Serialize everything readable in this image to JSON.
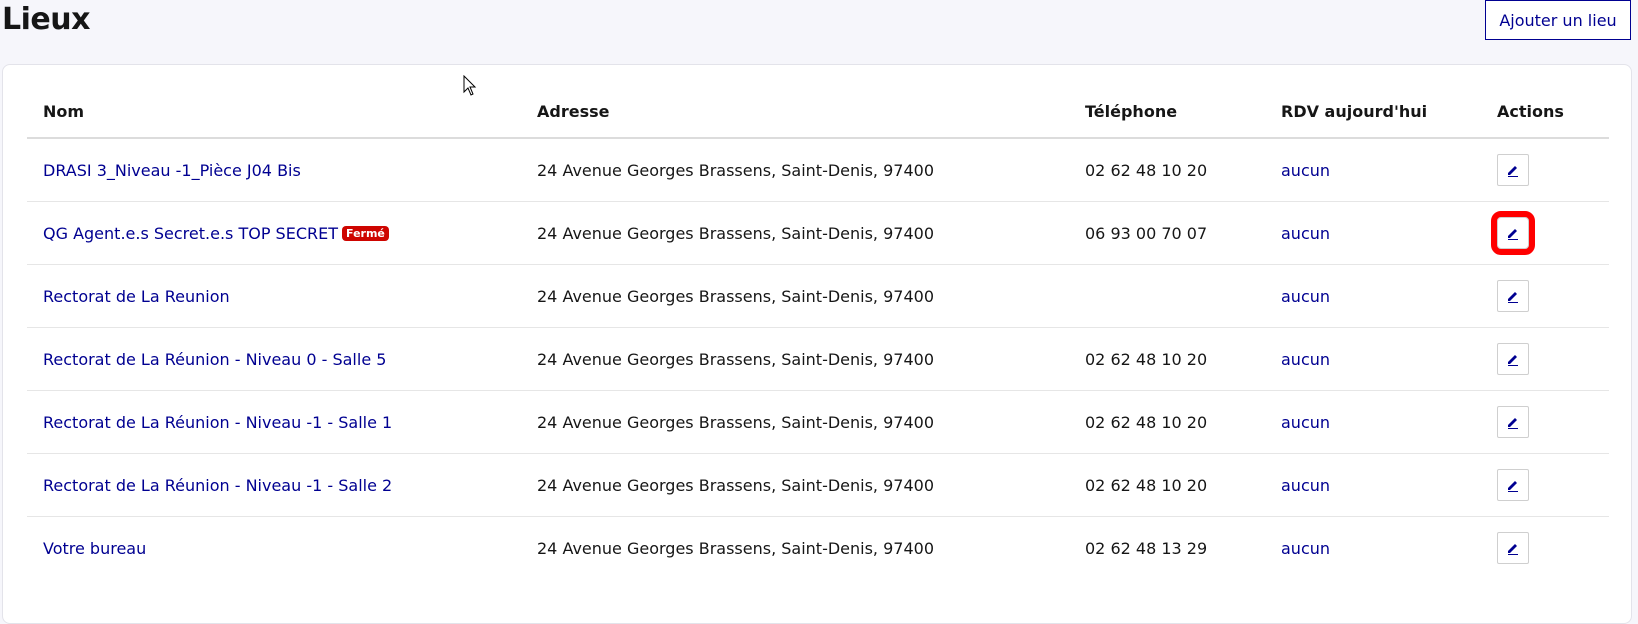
{
  "page": {
    "title": "Lieux",
    "add_button_label": "Ajouter un lieu"
  },
  "table": {
    "headers": {
      "nom": "Nom",
      "adresse": "Adresse",
      "telephone": "Téléphone",
      "rdv": "RDV aujourd'hui",
      "actions": "Actions"
    },
    "rows": [
      {
        "nom": "DRASI 3_Niveau -1_Pièce J04 Bis",
        "badge": "",
        "adresse": "24 Avenue Georges Brassens, Saint-Denis, 97400",
        "telephone": "02 62 48 10 20",
        "rdv": "aucun"
      },
      {
        "nom": "QG Agent.e.s Secret.e.s TOP SECRET",
        "badge": "Fermé",
        "adresse": "24 Avenue Georges Brassens, Saint-Denis, 97400",
        "telephone": "06 93 00 70 07",
        "rdv": "aucun",
        "highlighted": true
      },
      {
        "nom": "Rectorat de La Reunion",
        "badge": "",
        "adresse": "24 Avenue Georges Brassens, Saint-Denis, 97400",
        "telephone": "",
        "rdv": "aucun"
      },
      {
        "nom": "Rectorat de La Réunion - Niveau 0 - Salle 5",
        "badge": "",
        "adresse": "24 Avenue Georges Brassens, Saint-Denis, 97400",
        "telephone": "02 62 48 10 20",
        "rdv": "aucun"
      },
      {
        "nom": "Rectorat de La Réunion - Niveau -1 - Salle 1",
        "badge": "",
        "adresse": "24 Avenue Georges Brassens, Saint-Denis, 97400",
        "telephone": "02 62 48 10 20",
        "rdv": "aucun"
      },
      {
        "nom": "Rectorat de La Réunion - Niveau -1 - Salle 2",
        "badge": "",
        "adresse": "24 Avenue Georges Brassens, Saint-Denis, 97400",
        "telephone": "02 62 48 10 20",
        "rdv": "aucun"
      },
      {
        "nom": "Votre bureau",
        "badge": "",
        "adresse": "24 Avenue Georges Brassens, Saint-Denis, 97400",
        "telephone": "02 62 48 13 29",
        "rdv": "aucun"
      }
    ]
  },
  "icons": {
    "edit": "pencil-icon",
    "cursor": "mouse-cursor-icon"
  },
  "colors": {
    "link": "#000091",
    "badge": "#ce0500",
    "highlight": "#ff0000"
  }
}
